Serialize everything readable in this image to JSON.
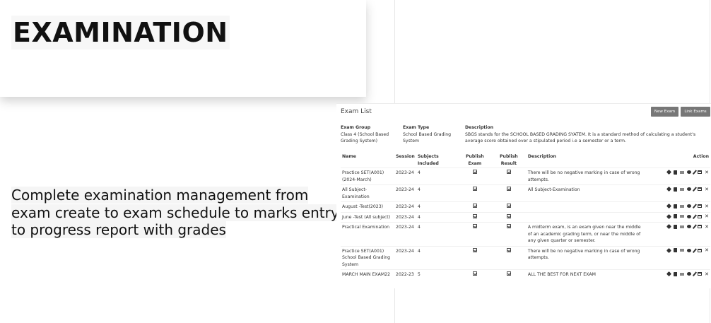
{
  "hero": {
    "title": "EXAMINATION",
    "description_lines": [
      "Complete examination management from",
      "exam create to exam schedule to marks entry",
      "to progress report  with grades"
    ]
  },
  "panel": {
    "title": "Exam List",
    "buttons": {
      "new_exam": "New Exam",
      "link_exams": "Link Exams"
    },
    "meta": {
      "group_label": "Exam Group",
      "group_value": "Class 4 (School Based Grading System)",
      "type_label": "Exam Type",
      "type_value": "School Based Grading System",
      "desc_label": "Description",
      "desc_value": "SBGS stands for the SCHOOL BASED GRADING SYATEM. It is a standard method of calculating a student's average score obtained over a stipulated period i.e a semester or a term."
    },
    "columns": [
      "Name",
      "Session",
      "Subjects Included",
      "Publish Exam",
      "Publish Result",
      "Description",
      "Action"
    ],
    "rows": [
      {
        "name": "Practice SET(A001) (2024-March)",
        "session": "2023-24",
        "subjects": "4",
        "description": "There will be no negative marking in case of wrong attempts."
      },
      {
        "name": "All Subject-Examination",
        "session": "2023-24",
        "subjects": "4",
        "description": "All Subject-Examination"
      },
      {
        "name": "August -Test(2023)",
        "session": "2023-24",
        "subjects": "4",
        "description": ""
      },
      {
        "name": "June -Test (All subject)",
        "session": "2023-24",
        "subjects": "4",
        "description": ""
      },
      {
        "name": "Practical Examination",
        "session": "2023-24",
        "subjects": "4",
        "description": "A midterm exam, is an exam given near the middle of an academic grading term, or near the middle of any given quarter or semester."
      },
      {
        "name": "Practice SET(A001) School Based Grading System",
        "session": "2023-24",
        "subjects": "4",
        "description": "There will be no negative marking in case of wrong attempts."
      },
      {
        "name": "MARCH MAIN EXAM22",
        "session": "2022-23",
        "subjects": "5",
        "description": "ALL THE BEST FOR NEXT EXAM"
      }
    ],
    "action_icons": [
      "tag-icon",
      "book-icon",
      "card-icon",
      "comment-icon",
      "pencil-icon",
      "calendar-icon",
      "close-icon"
    ]
  }
}
